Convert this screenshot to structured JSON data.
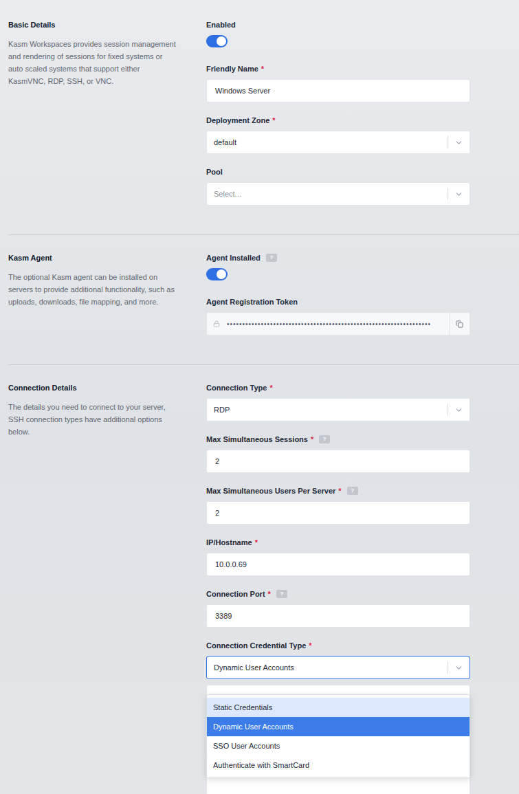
{
  "required_mark": "*",
  "help_mark": "?",
  "sections": [
    {
      "title": "Basic Details",
      "description": "Kasm Workspaces provides session management and rendering of sessions for fixed systems or auto scaled systems that support either KasmVNC, RDP, SSH, or VNC.",
      "fields": [
        {
          "kind": "toggle",
          "label": "Enabled",
          "required": false,
          "help": false,
          "on": true
        },
        {
          "kind": "input",
          "label": "Friendly Name",
          "required": true,
          "help": false,
          "value": "Windows Server"
        },
        {
          "kind": "select",
          "label": "Deployment Zone",
          "required": true,
          "help": false,
          "value": "default",
          "placeholder": false
        },
        {
          "kind": "select",
          "label": "Pool",
          "required": false,
          "help": false,
          "value": "Select...",
          "placeholder": true
        }
      ]
    },
    {
      "title": "Kasm Agent",
      "description": "The optional Kasm agent can be installed on servers to provide additional functionality, such as uploads, downloads, file mapping, and more.",
      "fields": [
        {
          "kind": "toggle",
          "label": "Agent Installed",
          "required": false,
          "help": true,
          "on": true
        },
        {
          "kind": "secret",
          "label": "Agent Registration Token",
          "required": false,
          "help": false,
          "value": "••••••••••••••••••••••••••••••••••••••••••••••••••••••••••••••••••"
        }
      ]
    },
    {
      "title": "Connection Details",
      "description": "The details you need to connect to your server, SSH connection types have additional options below.",
      "fields": [
        {
          "kind": "select",
          "label": "Connection Type",
          "required": true,
          "help": false,
          "value": "RDP",
          "placeholder": false
        },
        {
          "kind": "input",
          "label": "Max Simultaneous Sessions",
          "required": true,
          "help": true,
          "value": "2"
        },
        {
          "kind": "input",
          "label": "Max Simultaneous Users Per Server",
          "required": true,
          "help": true,
          "value": "2"
        },
        {
          "kind": "input",
          "label": "IP/Hostname",
          "required": true,
          "help": false,
          "value": "10.0.0.69"
        },
        {
          "kind": "input",
          "label": "Connection Port",
          "required": true,
          "help": true,
          "value": "3389"
        },
        {
          "kind": "select-open",
          "label": "Connection Credential Type",
          "required": true,
          "help": false,
          "value": "Dynamic User Accounts",
          "focused": true,
          "options": [
            {
              "label": "Static Credentials",
              "selected": false,
              "hovered": true
            },
            {
              "label": "Dynamic User Accounts",
              "selected": true,
              "hovered": false
            },
            {
              "label": "SSO User Accounts",
              "selected": false,
              "hovered": false
            },
            {
              "label": "Authenticate with SmartCard",
              "selected": false,
              "hovered": false
            }
          ]
        },
        {
          "kind": "textarea"
        }
      ]
    }
  ]
}
